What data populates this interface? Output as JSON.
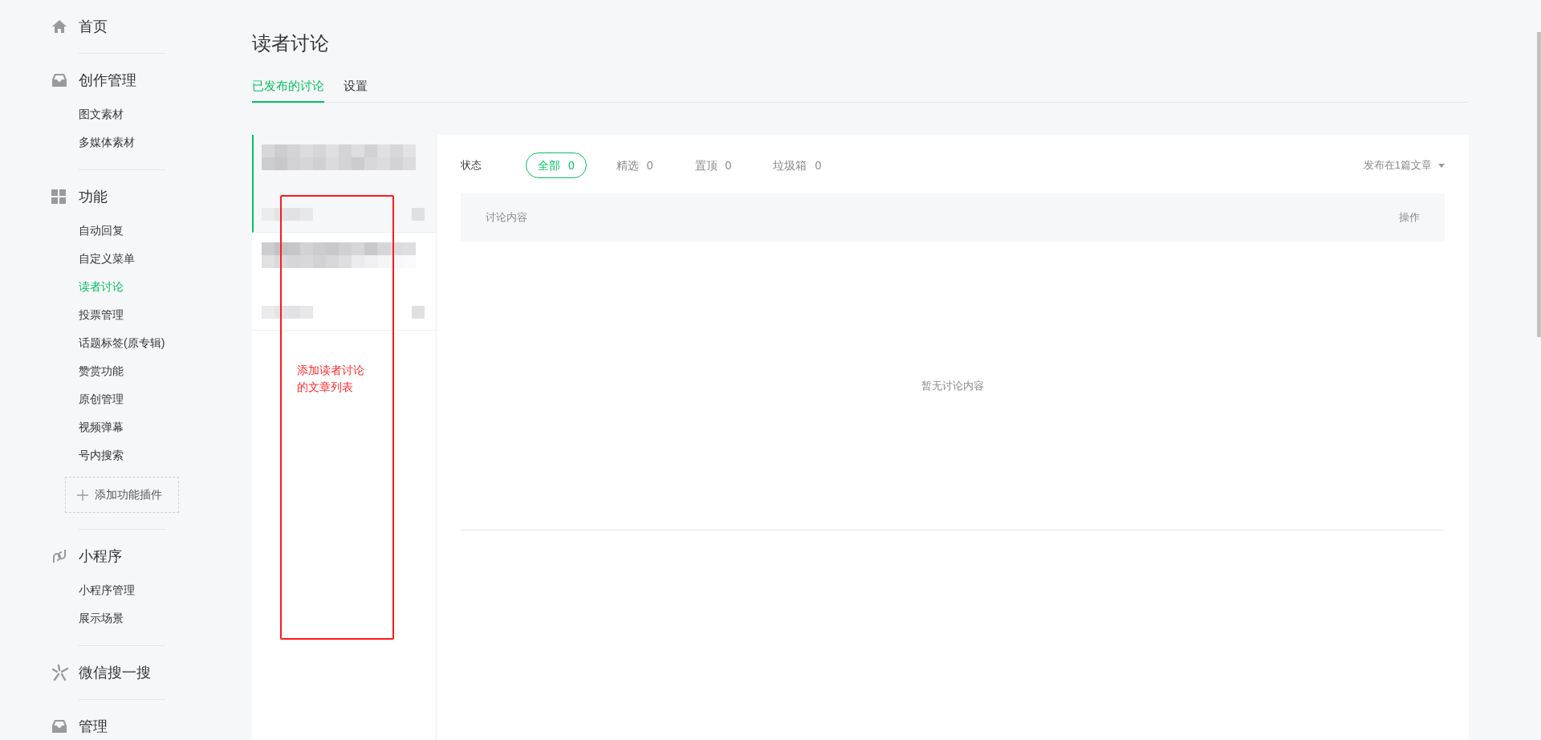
{
  "sidebar": {
    "groups": [
      {
        "title": "首页"
      },
      {
        "title": "创作管理",
        "items": [
          {
            "label": "图文素材",
            "selected": false
          },
          {
            "label": "多媒体素材",
            "selected": false
          }
        ]
      },
      {
        "title": "功能",
        "items": [
          {
            "label": "自动回复",
            "selected": false
          },
          {
            "label": "自定义菜单",
            "selected": false
          },
          {
            "label": "读者讨论",
            "selected": true
          },
          {
            "label": "投票管理",
            "selected": false
          },
          {
            "label": "话题标签(原专辑)",
            "selected": false
          },
          {
            "label": "赞赏功能",
            "selected": false
          },
          {
            "label": "原创管理",
            "selected": false
          },
          {
            "label": "视频弹幕",
            "selected": false
          },
          {
            "label": "号内搜索",
            "selected": false
          }
        ],
        "add_button": "添加功能插件"
      },
      {
        "title": "小程序",
        "items": [
          {
            "label": "小程序管理",
            "selected": false
          },
          {
            "label": "展示场景",
            "selected": false
          }
        ]
      },
      {
        "title": "微信搜一搜"
      },
      {
        "title": "管理"
      }
    ]
  },
  "page": {
    "title": "读者讨论",
    "tabs": [
      {
        "label": "已发布的讨论",
        "selected": true
      },
      {
        "label": "设置",
        "selected": false
      }
    ]
  },
  "articles": [
    {
      "selected": true
    },
    {
      "selected": false
    }
  ],
  "annotation": {
    "text": "添加读者讨论的文章列表"
  },
  "filters": {
    "label": "状态",
    "options": [
      {
        "label": "全部",
        "count": "0",
        "selected": true
      },
      {
        "label": "精选",
        "count": "0",
        "selected": false
      },
      {
        "label": "置顶",
        "count": "0",
        "selected": false
      },
      {
        "label": "垃圾箱",
        "count": "0",
        "selected": false
      }
    ],
    "dropdown": "发布在1篇文章"
  },
  "table": {
    "columns": [
      "讨论内容",
      "操作"
    ],
    "empty": "暂无讨论内容"
  }
}
